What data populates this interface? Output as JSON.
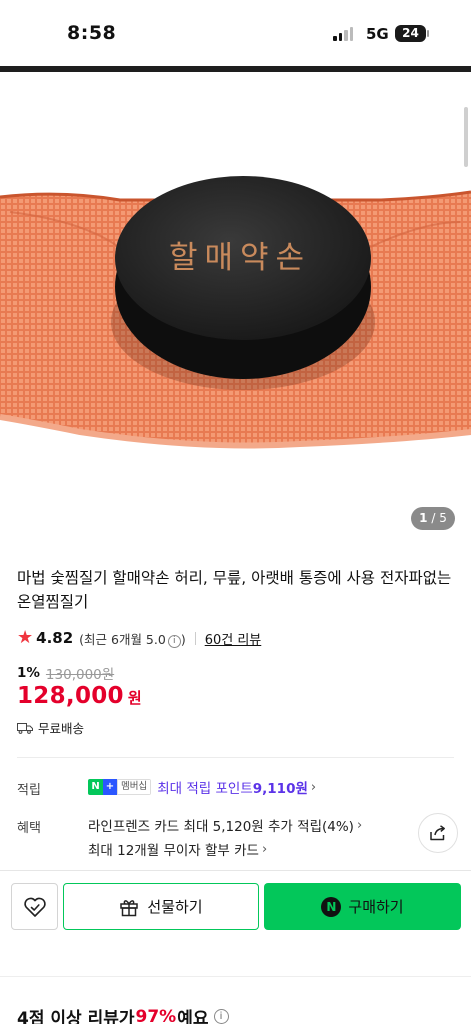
{
  "status_bar": {
    "time": "8:58",
    "network": "5G",
    "battery": "24"
  },
  "gallery": {
    "stone_text": "할매약손",
    "counter_current": "1",
    "counter_sep": " / ",
    "counter_total": "5"
  },
  "product": {
    "title": "마법 숯찜질기 할매약손 허리, 무릎, 아랫배 통증에 사용 전자파없는 온열찜질기",
    "rating": "4.82",
    "rating_recent": "(최근 6개월 5.0",
    "rating_recent_close": ")",
    "review_count": "60건 리뷰",
    "discount_rate": "1%",
    "original_price": "130,000원",
    "sale_price": "128,000",
    "sale_unit": "원",
    "shipping": "무료배송"
  },
  "benefits": {
    "points_label": "적립",
    "badge_n": "N",
    "badge_plus": "+",
    "badge_member": "멤버십",
    "points_text": "최대 적립 포인트 ",
    "points_value": "9,110원",
    "benefit_label": "혜택",
    "card_benefit": "라인프렌즈 카드 최대 5,120원 추가 적립(4%)",
    "installment": "최대 12개월 무이자 할부 카드"
  },
  "actions": {
    "gift_label": "선물하기",
    "buy_badge": "N",
    "buy_label": "구매하기"
  },
  "reviews": {
    "summary_prefix": "4점 이상 리뷰가 ",
    "summary_pct": "97%",
    "summary_suffix": "예요"
  },
  "colors": {
    "accent_green": "#03c75a",
    "price_red": "#e4002b",
    "points_purple": "#5b33e8",
    "mesh_orange": "#e87a52"
  }
}
